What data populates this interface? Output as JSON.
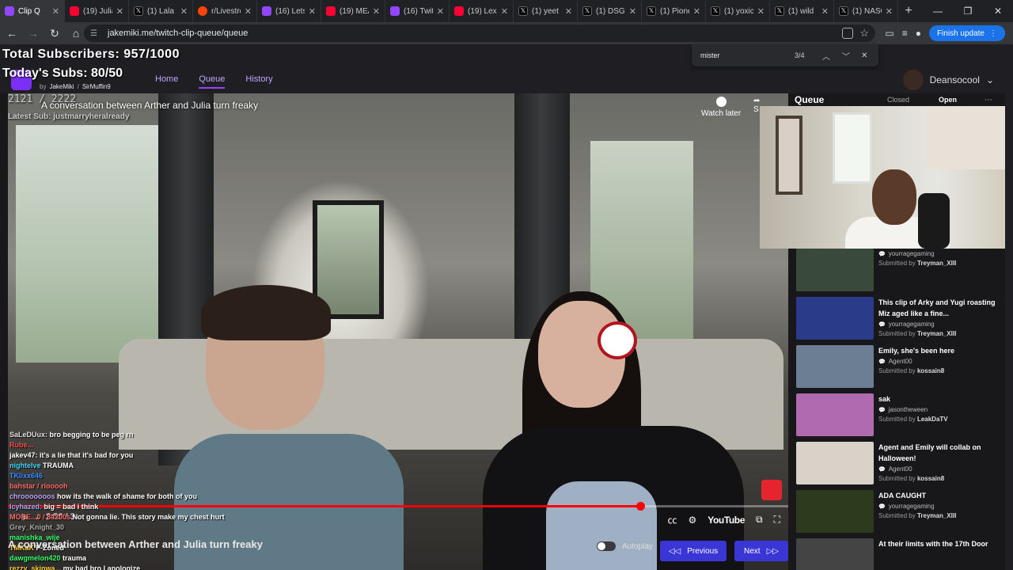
{
  "browser": {
    "tabs": [
      {
        "label": "Clip Q",
        "icon": "twitch-icon",
        "active": true
      },
      {
        "label": "(19) Julia",
        "icon": "youtube-icon"
      },
      {
        "label": "(1) Lala o",
        "icon": "x-icon"
      },
      {
        "label": "r/Livestre",
        "icon": "reddit-icon"
      },
      {
        "label": "(16) Lets",
        "icon": "twitch-icon"
      },
      {
        "label": "(19) MEA",
        "icon": "youtube-icon"
      },
      {
        "label": "(16) Twitc",
        "icon": "twitch-icon"
      },
      {
        "label": "(19) Lex L",
        "icon": "youtube-icon"
      },
      {
        "label": "(1) yeet (",
        "icon": "x-icon"
      },
      {
        "label": "(1) DSG T",
        "icon": "x-icon"
      },
      {
        "label": "(1) Pione",
        "icon": "x-icon"
      },
      {
        "label": "(1) yoxic",
        "icon": "x-icon"
      },
      {
        "label": "(1) wild",
        "icon": "x-icon"
      },
      {
        "label": "(1) NASC",
        "icon": "x-icon"
      }
    ],
    "new_tab": "+",
    "url": "jakemiki.me/twitch-clip-queue/queue",
    "finish_update": "Finish update",
    "find": {
      "query": "mister",
      "count": "3/4"
    }
  },
  "overlay": {
    "total_subs": "Total Subscribers: 957/1000",
    "today_subs": "Today's Subs: 80/50",
    "sub_count": "2121 / 2222",
    "latest_sub": "Latest Sub: justmarryheralready"
  },
  "site": {
    "by": "by",
    "credit1": "JakeMiki",
    "separator": "/",
    "credit2": "SirMuffin9",
    "nav": [
      "Home",
      "Queue",
      "History"
    ],
    "active_nav": "Queue",
    "username": "Deansocool"
  },
  "video": {
    "title": "A conversation between Arther and Julia turn freaky",
    "watch_later": "Watch later",
    "share": "S",
    "time": "2:56 / 3",
    "youtube_label": "YouTube",
    "progress": 0.81
  },
  "chat": [
    {
      "user": "SaLeDUux:",
      "msg": "bro begging to be peg rn",
      "color": "#e0e0e0"
    },
    {
      "user": "Rube...",
      "msg": "",
      "color": "#ff5050"
    },
    {
      "user": "jakev47:",
      "msg": "it's a lie that it's bad for you",
      "color": "#ffffff"
    },
    {
      "user": "nightelve",
      "msg": "TRAUMA",
      "color": "#46d4ff"
    },
    {
      "user": "TKlixx646",
      "msg": "",
      "color": "#3a8dff"
    },
    {
      "user": "bahstar / riooooh",
      "msg": "",
      "color": "#ff6b6b"
    },
    {
      "user": "chrooooooos",
      "msg": "how its the walk of shame for both of you",
      "color": "#c2a2ff"
    },
    {
      "user": "Icyhazed:",
      "msg": "big = bad i think",
      "color": "#8ab4ff"
    },
    {
      "user": "MORE...0 / 84200s",
      "msg": "Not gonna lie. This story make my chest hurt",
      "color": "#ff6b6b"
    },
    {
      "user": "Grey_Knight_30",
      "msg": "",
      "color": "#aaaaaa"
    },
    {
      "user": "manishka_wije",
      "msg": "",
      "color": "#35ff6a"
    },
    {
      "user": "TMKaK",
      "msg": "F-Zoned",
      "color": "#ffcc33"
    },
    {
      "user": "dawgmelon420",
      "msg": "trauma",
      "color": "#35ff6a"
    },
    {
      "user": "rezzy_skinwa...",
      "msg": "my bad bro I apologize",
      "color": "#ffcc33"
    }
  ],
  "queue": {
    "title": "Queue",
    "closed": "Closed",
    "open": "Open",
    "items": [
      {
        "title": "",
        "channel": "yourragegaming",
        "submitted_by": "Treyman_XIII",
        "thumb": "#3a4a3a"
      },
      {
        "title": "This clip of Arky and Yugi roasting Miz aged like a fine...",
        "channel": "yourragegaming",
        "submitted_by": "Treyman_XIII",
        "thumb": "#2a3b8a"
      },
      {
        "title": "Emily, she's been here",
        "channel": "Agent00",
        "submitted_by": "kossain8",
        "thumb": "#6b7e94"
      },
      {
        "title": "sak",
        "channel": "jasontheween",
        "submitted_by": "LeakDaTV",
        "thumb": "#b06ab0"
      },
      {
        "title": "Agent and Emily will collab on Halloween!",
        "channel": "Agent00",
        "submitted_by": "kossain8",
        "thumb": "#d8d2c8"
      },
      {
        "title": "ADA CAUGHT",
        "channel": "yourragegaming",
        "submitted_by": "Treyman_XIII",
        "thumb": "#2e3a1e"
      },
      {
        "title": "At their limits with the 17th Door",
        "channel": "",
        "submitted_by": "",
        "thumb": "#444"
      }
    ],
    "submitted_prefix": "Submitted by"
  },
  "footer": {
    "title": "A conversation between Arther and Julia turn freaky",
    "autoplay": "Autoplay",
    "previous": "Previous",
    "next": "Next"
  },
  "colors": {
    "accent": "#9146ff",
    "button": "#3a36d6",
    "progress": "#ff0000"
  }
}
